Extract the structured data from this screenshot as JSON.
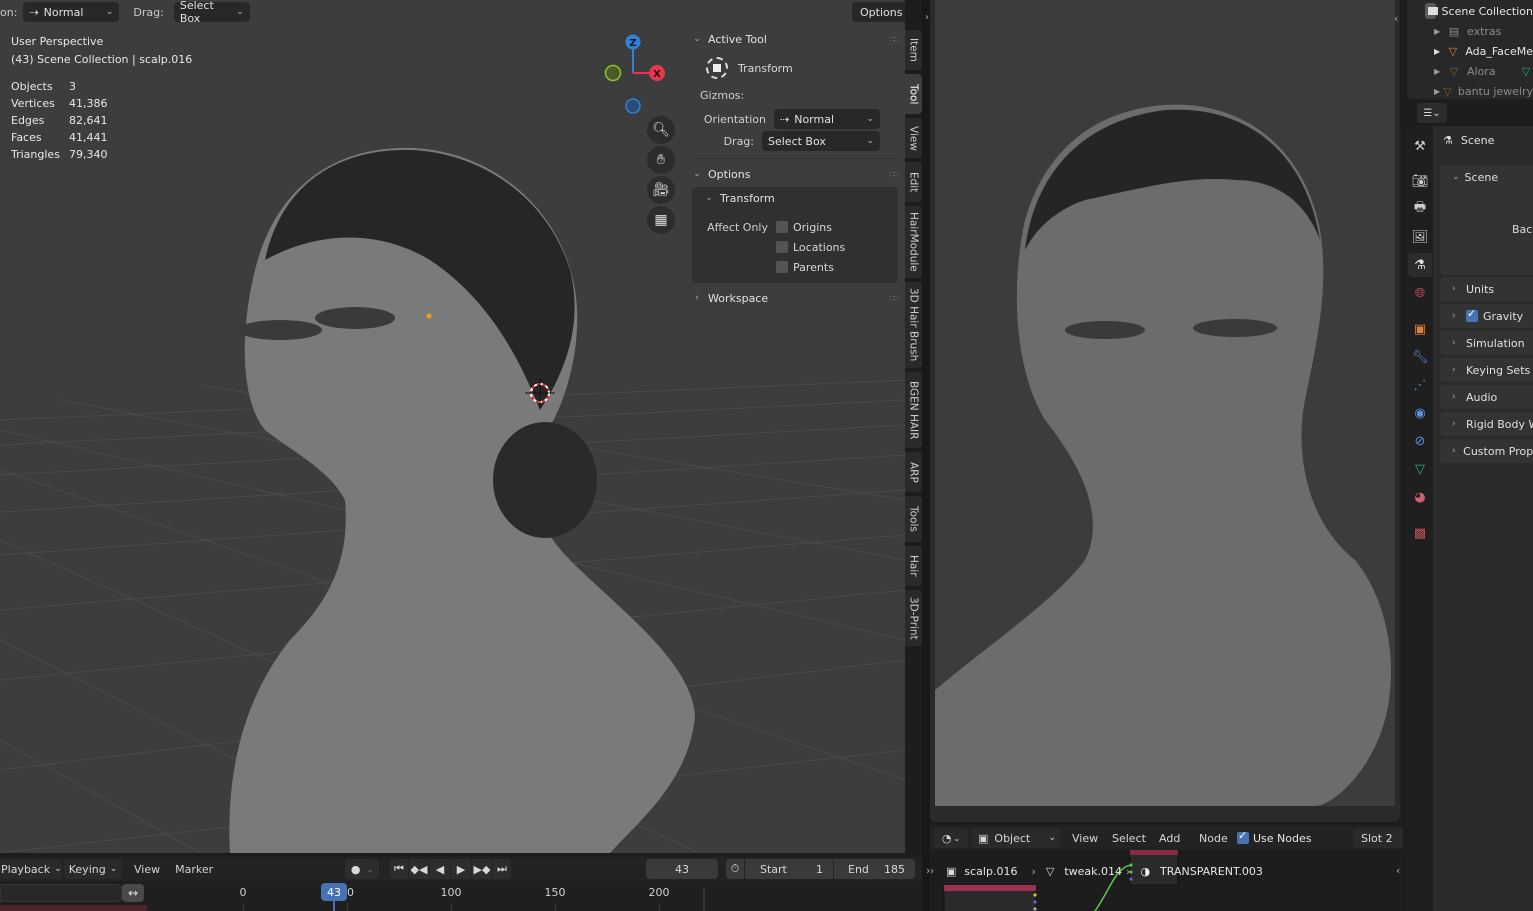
{
  "viewport": {
    "header": {
      "orientation_label_partial": "on:",
      "orientation_value": "Normal",
      "drag_label": "Drag:",
      "drag_value": "Select Box",
      "options_label": "Options"
    },
    "info": {
      "view_name": "User Perspective",
      "collection_line": "(43) Scene Collection | scalp.016",
      "stats": [
        {
          "label": "Objects",
          "value": "3"
        },
        {
          "label": "Vertices",
          "value": "41,386"
        },
        {
          "label": "Edges",
          "value": "82,641"
        },
        {
          "label": "Faces",
          "value": "41,441"
        },
        {
          "label": "Triangles",
          "value": "79,340"
        }
      ]
    },
    "gizmo": {
      "z_label": "Z",
      "x_label": "X",
      "colors": {
        "x": "#e8364f",
        "y": "#8bc32c",
        "z": "#2f82d8"
      }
    },
    "nav_buttons": [
      "zoom-icon",
      "pan-hand-icon",
      "camera-icon",
      "grid-ortho-icon"
    ]
  },
  "npanel": {
    "active_tool": {
      "title": "Active Tool",
      "tool_name": "Transform",
      "gizmos_label": "Gizmos:",
      "orientation_label": "Orientation",
      "orientation_value": "Normal",
      "drag_label": "Drag:",
      "drag_value": "Select Box"
    },
    "options": {
      "title": "Options",
      "transform_title": "Transform",
      "affect_only_label": "Affect Only",
      "checkboxes": [
        {
          "label": "Origins",
          "checked": false
        },
        {
          "label": "Locations",
          "checked": false
        },
        {
          "label": "Parents",
          "checked": false
        }
      ]
    },
    "workspace": {
      "title": "Workspace"
    },
    "tabs": [
      "Item",
      "Tool",
      "View",
      "Edit",
      "HairModule",
      "3D Hair Brush",
      "BGEN HAIR",
      "ARP",
      "Tools",
      "Hair",
      "3D-Print"
    ],
    "active_tab": "Tool"
  },
  "outliner": {
    "root": "Scene Collection",
    "items": [
      {
        "label": "extras",
        "dim": true
      },
      {
        "label": "Ada_FaceMe",
        "dim": false
      },
      {
        "label": "Alora",
        "dim": true
      },
      {
        "label": "bantu jewelry",
        "dim": true
      }
    ]
  },
  "properties": {
    "context_title": "Scene",
    "panels": [
      {
        "label": "Scene",
        "expanded": true
      },
      {
        "label": "Units",
        "expanded": false
      },
      {
        "label": "Gravity",
        "expanded": false,
        "checkbox": true
      },
      {
        "label": "Simulation",
        "expanded": false
      },
      {
        "label": "Keying Sets",
        "expanded": false
      },
      {
        "label": "Audio",
        "expanded": false
      },
      {
        "label": "Rigid Body W",
        "expanded": false
      },
      {
        "label": "Custom Prope",
        "expanded": false
      }
    ],
    "scene_partial_text": "Backg",
    "tabs": [
      "tool-icon",
      "render-icon",
      "output-icon",
      "view-layer-icon",
      "scene-icon",
      "world-icon",
      "object-icon",
      "modifier-icon",
      "particles-icon",
      "physics-icon",
      "constraints-icon",
      "data-icon",
      "material-icon",
      "texture-icon"
    ]
  },
  "timeline": {
    "menus": [
      "Playback",
      "Keying",
      "View",
      "Marker"
    ],
    "current_frame": "43",
    "start_label": "Start",
    "start_value": "1",
    "end_label": "End",
    "end_value": "185",
    "ruler": [
      "0",
      "50",
      "100",
      "150",
      "200"
    ],
    "playhead_frame": "43"
  },
  "node_editor": {
    "object_mode": "Object",
    "menus": [
      "View",
      "Select",
      "Add",
      "Node"
    ],
    "use_nodes_label": "Use Nodes",
    "use_nodes_checked": true,
    "slot": "Slot 2",
    "breadcrumb": [
      "scalp.016",
      "tweak.014",
      "TRANSPARENT.003"
    ]
  }
}
